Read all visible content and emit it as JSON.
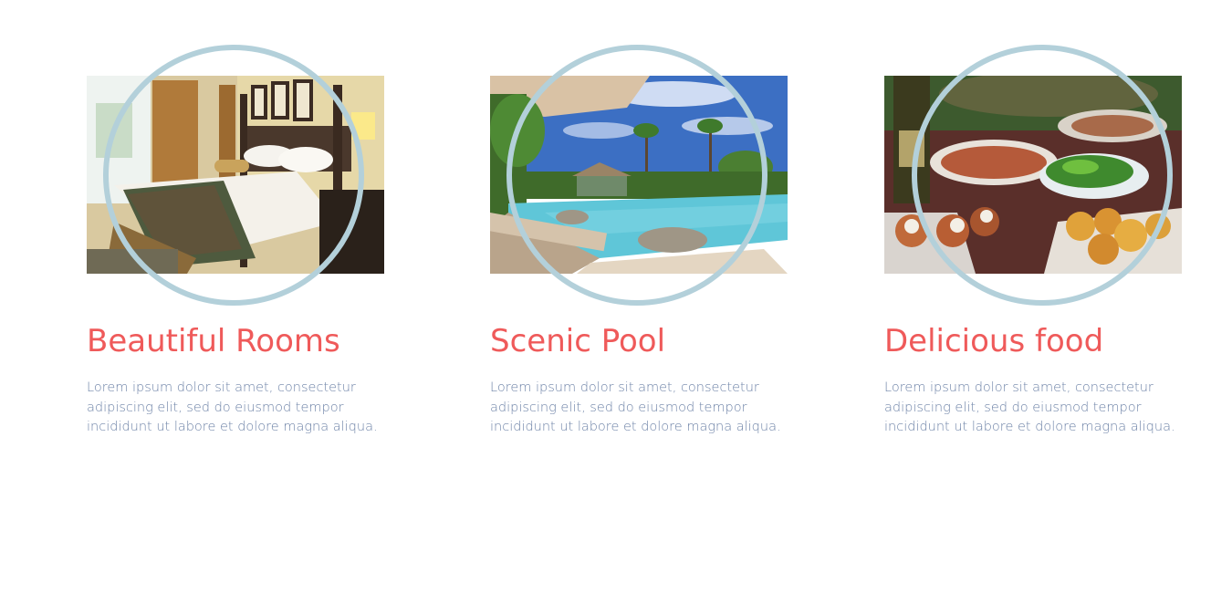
{
  "features": [
    {
      "image_subject": "hotel bedroom photo",
      "title": "Beautiful Rooms",
      "description": "Lorem ipsum dolor sit amet, consectetur adipiscing elit, sed do eiusmod tempor incididunt ut labore et dolore magna aliqua."
    },
    {
      "image_subject": "resort swimming pool photo",
      "title": "Scenic Pool",
      "description": "Lorem ipsum dolor sit amet, consectetur adipiscing elit, sed do eiusmod tempor incididunt ut labore et dolore magna aliqua."
    },
    {
      "image_subject": "plated food dishes photo",
      "title": "Delicious food",
      "description": "Lorem ipsum dolor sit amet, consectetur adipiscing elit, sed do eiusmod tempor incididunt ut labore et dolore magna aliqua."
    }
  ],
  "colors": {
    "title": "#ef5a5a",
    "description": "#6f84a8",
    "ring": "#b3d0da",
    "background": "#ffffff"
  }
}
